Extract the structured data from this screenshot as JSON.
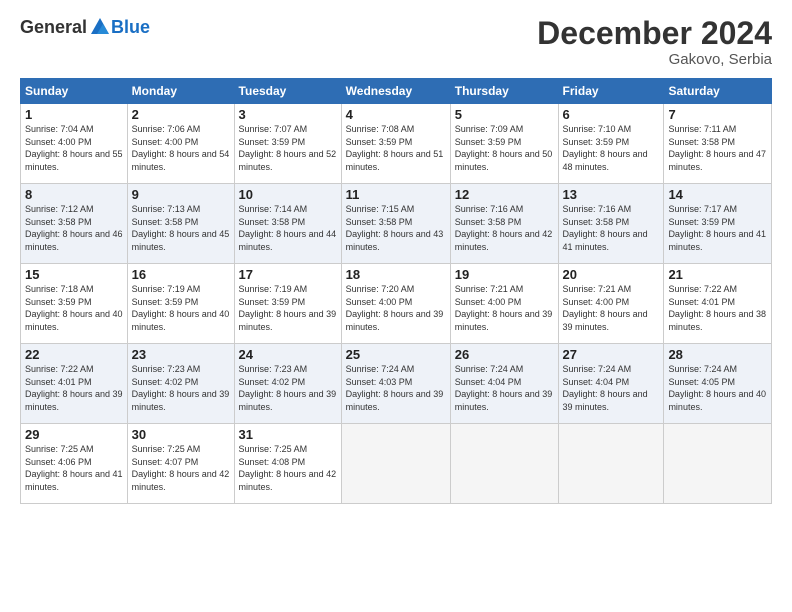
{
  "header": {
    "logo_general": "General",
    "logo_blue": "Blue",
    "month_title": "December 2024",
    "location": "Gakovo, Serbia"
  },
  "days_of_week": [
    "Sunday",
    "Monday",
    "Tuesday",
    "Wednesday",
    "Thursday",
    "Friday",
    "Saturday"
  ],
  "weeks": [
    [
      {
        "day": "1",
        "sunrise": "Sunrise: 7:04 AM",
        "sunset": "Sunset: 4:00 PM",
        "daylight": "Daylight: 8 hours and 55 minutes."
      },
      {
        "day": "2",
        "sunrise": "Sunrise: 7:06 AM",
        "sunset": "Sunset: 4:00 PM",
        "daylight": "Daylight: 8 hours and 54 minutes."
      },
      {
        "day": "3",
        "sunrise": "Sunrise: 7:07 AM",
        "sunset": "Sunset: 3:59 PM",
        "daylight": "Daylight: 8 hours and 52 minutes."
      },
      {
        "day": "4",
        "sunrise": "Sunrise: 7:08 AM",
        "sunset": "Sunset: 3:59 PM",
        "daylight": "Daylight: 8 hours and 51 minutes."
      },
      {
        "day": "5",
        "sunrise": "Sunrise: 7:09 AM",
        "sunset": "Sunset: 3:59 PM",
        "daylight": "Daylight: 8 hours and 50 minutes."
      },
      {
        "day": "6",
        "sunrise": "Sunrise: 7:10 AM",
        "sunset": "Sunset: 3:59 PM",
        "daylight": "Daylight: 8 hours and 48 minutes."
      },
      {
        "day": "7",
        "sunrise": "Sunrise: 7:11 AM",
        "sunset": "Sunset: 3:58 PM",
        "daylight": "Daylight: 8 hours and 47 minutes."
      }
    ],
    [
      {
        "day": "8",
        "sunrise": "Sunrise: 7:12 AM",
        "sunset": "Sunset: 3:58 PM",
        "daylight": "Daylight: 8 hours and 46 minutes."
      },
      {
        "day": "9",
        "sunrise": "Sunrise: 7:13 AM",
        "sunset": "Sunset: 3:58 PM",
        "daylight": "Daylight: 8 hours and 45 minutes."
      },
      {
        "day": "10",
        "sunrise": "Sunrise: 7:14 AM",
        "sunset": "Sunset: 3:58 PM",
        "daylight": "Daylight: 8 hours and 44 minutes."
      },
      {
        "day": "11",
        "sunrise": "Sunrise: 7:15 AM",
        "sunset": "Sunset: 3:58 PM",
        "daylight": "Daylight: 8 hours and 43 minutes."
      },
      {
        "day": "12",
        "sunrise": "Sunrise: 7:16 AM",
        "sunset": "Sunset: 3:58 PM",
        "daylight": "Daylight: 8 hours and 42 minutes."
      },
      {
        "day": "13",
        "sunrise": "Sunrise: 7:16 AM",
        "sunset": "Sunset: 3:58 PM",
        "daylight": "Daylight: 8 hours and 41 minutes."
      },
      {
        "day": "14",
        "sunrise": "Sunrise: 7:17 AM",
        "sunset": "Sunset: 3:59 PM",
        "daylight": "Daylight: 8 hours and 41 minutes."
      }
    ],
    [
      {
        "day": "15",
        "sunrise": "Sunrise: 7:18 AM",
        "sunset": "Sunset: 3:59 PM",
        "daylight": "Daylight: 8 hours and 40 minutes."
      },
      {
        "day": "16",
        "sunrise": "Sunrise: 7:19 AM",
        "sunset": "Sunset: 3:59 PM",
        "daylight": "Daylight: 8 hours and 40 minutes."
      },
      {
        "day": "17",
        "sunrise": "Sunrise: 7:19 AM",
        "sunset": "Sunset: 3:59 PM",
        "daylight": "Daylight: 8 hours and 39 minutes."
      },
      {
        "day": "18",
        "sunrise": "Sunrise: 7:20 AM",
        "sunset": "Sunset: 4:00 PM",
        "daylight": "Daylight: 8 hours and 39 minutes."
      },
      {
        "day": "19",
        "sunrise": "Sunrise: 7:21 AM",
        "sunset": "Sunset: 4:00 PM",
        "daylight": "Daylight: 8 hours and 39 minutes."
      },
      {
        "day": "20",
        "sunrise": "Sunrise: 7:21 AM",
        "sunset": "Sunset: 4:00 PM",
        "daylight": "Daylight: 8 hours and 39 minutes."
      },
      {
        "day": "21",
        "sunrise": "Sunrise: 7:22 AM",
        "sunset": "Sunset: 4:01 PM",
        "daylight": "Daylight: 8 hours and 38 minutes."
      }
    ],
    [
      {
        "day": "22",
        "sunrise": "Sunrise: 7:22 AM",
        "sunset": "Sunset: 4:01 PM",
        "daylight": "Daylight: 8 hours and 39 minutes."
      },
      {
        "day": "23",
        "sunrise": "Sunrise: 7:23 AM",
        "sunset": "Sunset: 4:02 PM",
        "daylight": "Daylight: 8 hours and 39 minutes."
      },
      {
        "day": "24",
        "sunrise": "Sunrise: 7:23 AM",
        "sunset": "Sunset: 4:02 PM",
        "daylight": "Daylight: 8 hours and 39 minutes."
      },
      {
        "day": "25",
        "sunrise": "Sunrise: 7:24 AM",
        "sunset": "Sunset: 4:03 PM",
        "daylight": "Daylight: 8 hours and 39 minutes."
      },
      {
        "day": "26",
        "sunrise": "Sunrise: 7:24 AM",
        "sunset": "Sunset: 4:04 PM",
        "daylight": "Daylight: 8 hours and 39 minutes."
      },
      {
        "day": "27",
        "sunrise": "Sunrise: 7:24 AM",
        "sunset": "Sunset: 4:04 PM",
        "daylight": "Daylight: 8 hours and 39 minutes."
      },
      {
        "day": "28",
        "sunrise": "Sunrise: 7:24 AM",
        "sunset": "Sunset: 4:05 PM",
        "daylight": "Daylight: 8 hours and 40 minutes."
      }
    ],
    [
      {
        "day": "29",
        "sunrise": "Sunrise: 7:25 AM",
        "sunset": "Sunset: 4:06 PM",
        "daylight": "Daylight: 8 hours and 41 minutes."
      },
      {
        "day": "30",
        "sunrise": "Sunrise: 7:25 AM",
        "sunset": "Sunset: 4:07 PM",
        "daylight": "Daylight: 8 hours and 42 minutes."
      },
      {
        "day": "31",
        "sunrise": "Sunrise: 7:25 AM",
        "sunset": "Sunset: 4:08 PM",
        "daylight": "Daylight: 8 hours and 42 minutes."
      },
      null,
      null,
      null,
      null
    ]
  ]
}
